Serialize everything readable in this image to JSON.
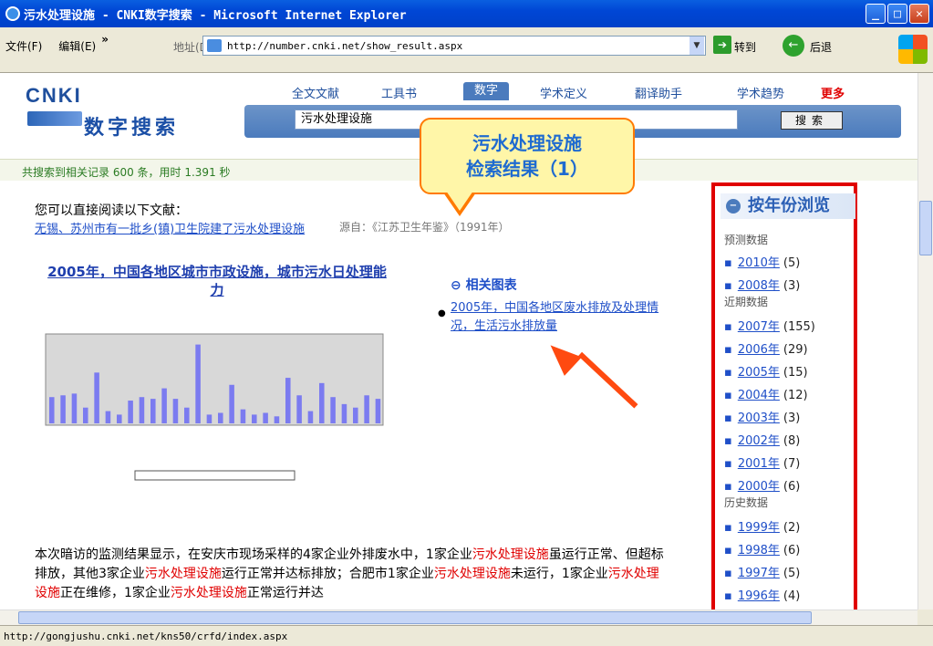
{
  "window": {
    "title": "污水处理设施 - CNKI数字搜索 - Microsoft Internet Explorer"
  },
  "menu": {
    "file": "文件(F)",
    "edit": "编辑(E)",
    "more": "»",
    "address_label": "地址(D)",
    "url": "http://number.cnki.net/show_result.aspx",
    "go": "转到",
    "back": "后退"
  },
  "status": {
    "url": "http://gongjushu.cnki.net/kns50/crfd/index.aspx"
  },
  "site": {
    "logo": "CNKI",
    "logo_sub": "数字搜索",
    "nav": [
      "全文文献",
      "工具书",
      "数字",
      "学术定义",
      "翻译助手",
      "学术趋势",
      "更多"
    ],
    "search_value": "污水处理设施",
    "search_button": "搜索"
  },
  "result_summary": "共搜索到相关记录 600 条，用时 1.391 秒",
  "callout": {
    "line1": "污水处理设施",
    "line2": "检索结果（1）"
  },
  "intro": "您可以直接阅读以下文献：",
  "first_result": {
    "link": "无锡、苏州市有一批乡(镇)卫生院建了污水处理设施",
    "source": "源自：《江苏卫生年鉴》（1991年）"
  },
  "figure": {
    "title": "2005年，中国各地区城市市政设施，城市污水日处理能力"
  },
  "related": {
    "heading": "相关图表",
    "link": "2005年，中国各地区废水排放及处理情况，生活污水排放量"
  },
  "body": {
    "p1": "本次暗访的监测结果显示，在安庆市现场采样的4家企业外排废水中，1家企业",
    "k1": "污水处理设施",
    "p2": "虽运行正常、但超标排放，其他3家企业",
    "k2": "污水处理设施",
    "p3": "运行正常并达标排放；合肥市1家企业",
    "k3": "污水处理设施",
    "p4": "未运行，1家企业",
    "k4": "污水处理设施",
    "p5": "正在维修，1家企业",
    "k5": "污水处理设施",
    "p6": "正常运行并达"
  },
  "sidebar": {
    "heading": "按年份浏览",
    "groups": [
      "预测数据",
      "近期数据",
      "历史数据"
    ],
    "items": [
      {
        "year": "2010年",
        "count": "(5)"
      },
      {
        "year": "2008年",
        "count": "(3)"
      },
      {
        "year": "2007年",
        "count": "(155)"
      },
      {
        "year": "2006年",
        "count": "(29)"
      },
      {
        "year": "2005年",
        "count": "(15)"
      },
      {
        "year": "2004年",
        "count": "(12)"
      },
      {
        "year": "2003年",
        "count": "(3)"
      },
      {
        "year": "2002年",
        "count": "(8)"
      },
      {
        "year": "2001年",
        "count": "(7)"
      },
      {
        "year": "2000年",
        "count": "(6)"
      },
      {
        "year": "1999年",
        "count": "(2)"
      },
      {
        "year": "1998年",
        "count": "(6)"
      },
      {
        "year": "1997年",
        "count": "(5)"
      },
      {
        "year": "1996年",
        "count": "(4)"
      }
    ]
  },
  "colors": {
    "accent": "#1f4fc8",
    "highlight": "#e00000",
    "callout_border": "#ff7a00",
    "sidebar_frame": "#e00000"
  },
  "chart_thumb": {
    "values": [
      30,
      32,
      34,
      18,
      58,
      14,
      10,
      26,
      30,
      28,
      40,
      28,
      18,
      90,
      10,
      12,
      44,
      16,
      10,
      12,
      8,
      52,
      32,
      14,
      46,
      30,
      22,
      18,
      32,
      28
    ]
  }
}
